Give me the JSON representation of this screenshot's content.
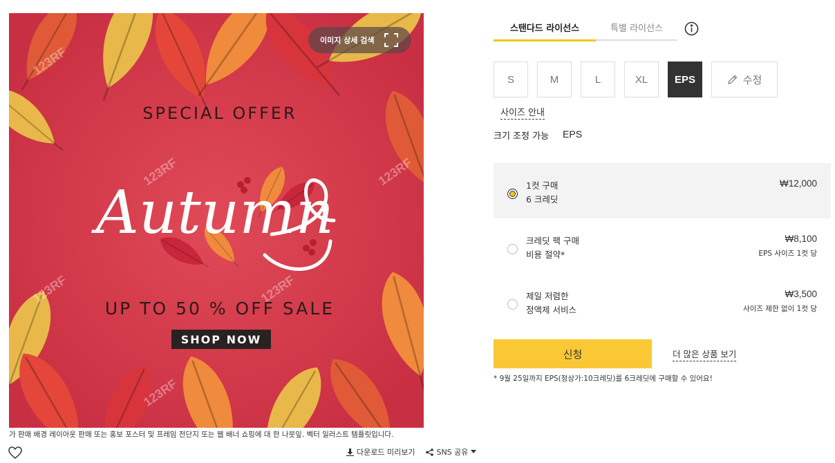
{
  "image": {
    "search_label": "이미지 상세 검색",
    "special_offer": "SPECIAL OFFER",
    "script_word": "Autumn",
    "sale_text": "UP TO 50 % OFF SALE",
    "shop_now": "SHOP NOW",
    "watermark": "123RF",
    "colors": {
      "background": "#d6394a",
      "leaf_orange": "#f08a3c",
      "leaf_yellow": "#e8b84a",
      "leaf_red": "#c8263a"
    }
  },
  "caption": "가 판매 배경 레이아웃 판매 또는 홍보 포스터 및 프레임 전단지 또는 웹 배너 쇼핑에 대 한 나뭇잎. 벡터 일러스트 템플릿입니다.",
  "actions": {
    "download_preview": "다운로드 미리보기",
    "sns_share": "SNS 공유"
  },
  "tabs": {
    "standard": "스탠다드 라이선스",
    "special": "특별 라이선스"
  },
  "sizes": [
    {
      "label": "S",
      "selected": false
    },
    {
      "label": "M",
      "selected": false
    },
    {
      "label": "L",
      "selected": false
    },
    {
      "label": "XL",
      "selected": false
    },
    {
      "label": "EPS",
      "selected": true
    }
  ],
  "edit_label": "수정",
  "size_guide": "사이즈 안내",
  "scalable": {
    "label": "크기 조정 가능",
    "format": "EPS"
  },
  "options": [
    {
      "title": "1컷 구매",
      "sub": "6 크레딧",
      "price": "₩12,000",
      "note": "",
      "selected": true
    },
    {
      "title": "크레딧 팩 구매",
      "sub": "비용 절약*",
      "price": "₩8,100",
      "note": "EPS 사이즈 1컷 당",
      "selected": false
    },
    {
      "title": "제일 저렴한",
      "sub": "정액제 서비스",
      "price": "₩3,500",
      "note": "사이즈 제한 없이 1컷 당",
      "selected": false
    }
  ],
  "apply_label": "신청",
  "more_link": "더 많은 상품 보기",
  "promo_note": "* 9월 25일까지 EPS(정상가:10크레딧)를 6크레딧에 구매할 수 있어요!",
  "accent_color": "#f9c834"
}
